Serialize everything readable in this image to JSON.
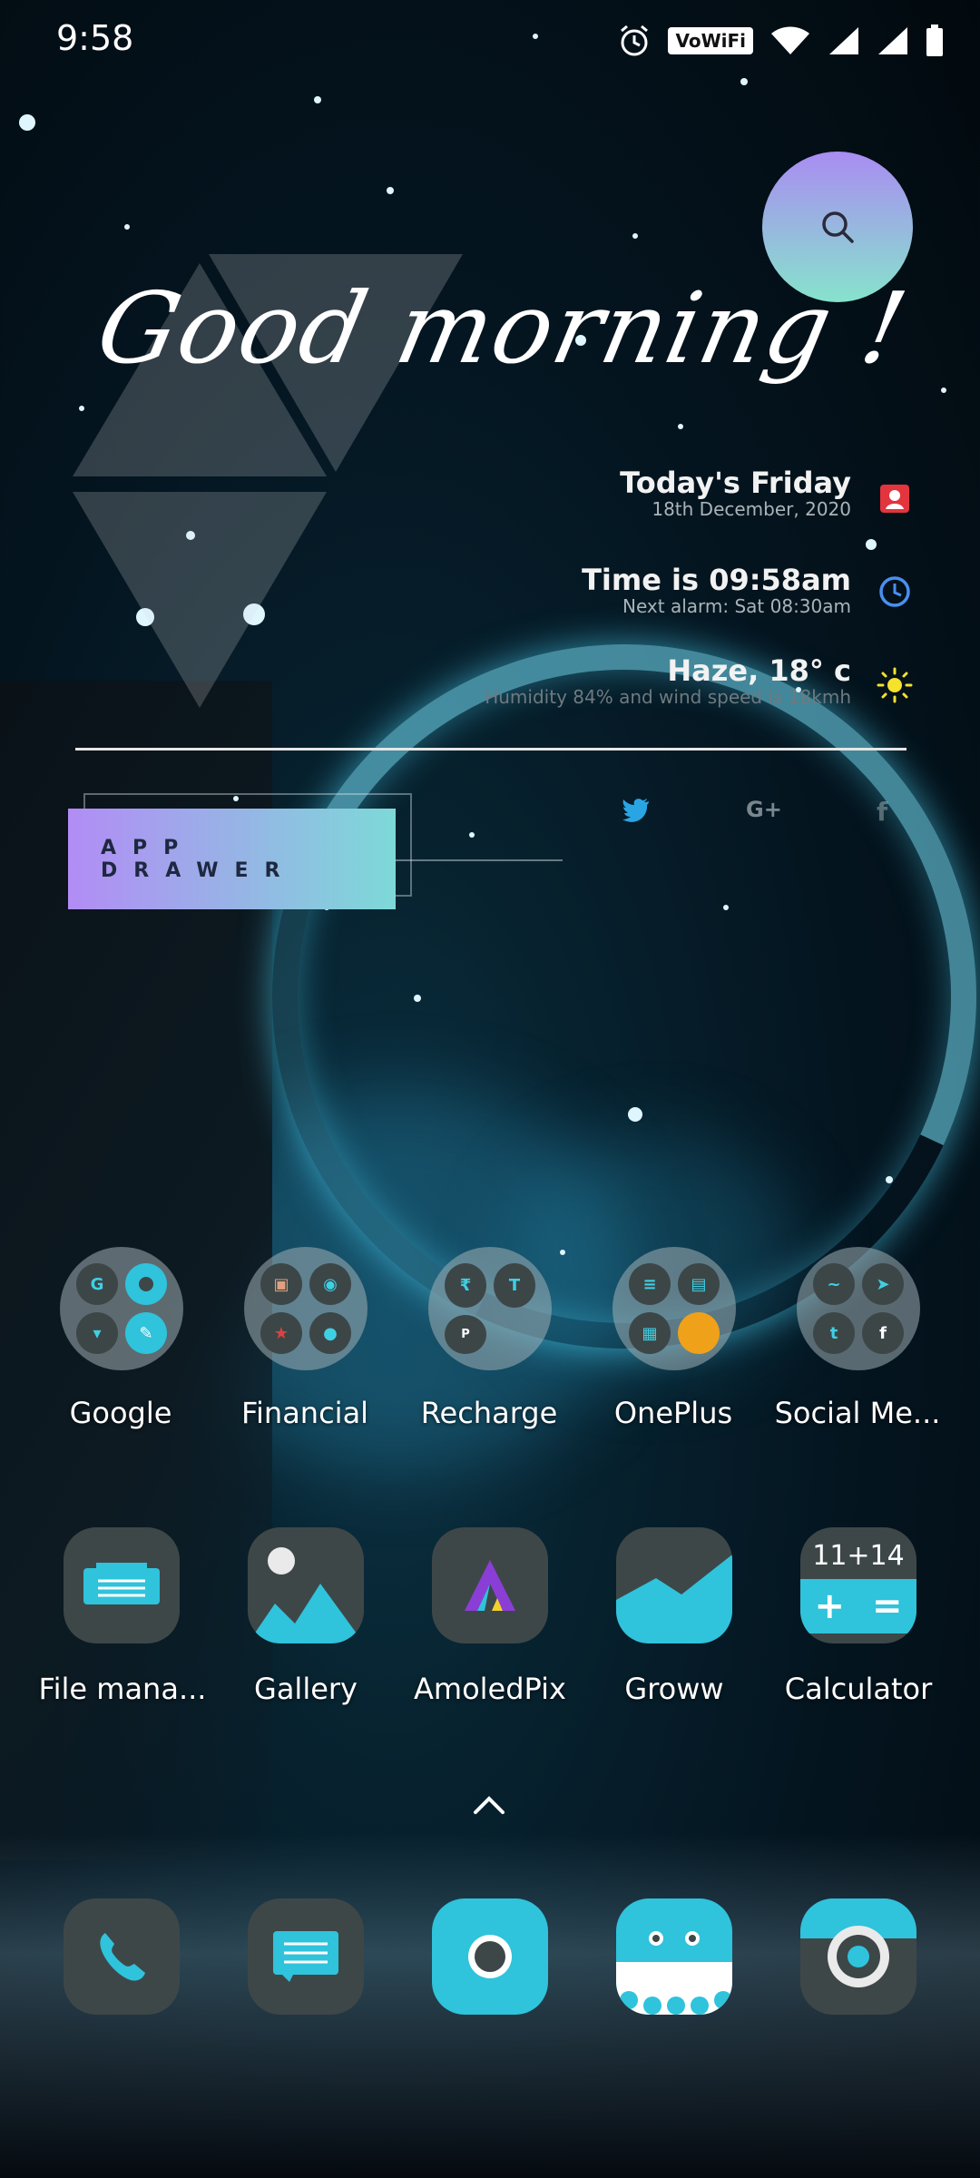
{
  "status_bar": {
    "time": "9:58",
    "badge": "VoWiFi"
  },
  "search": {
    "icon": "search-icon"
  },
  "greeting": "Good morning !",
  "info": {
    "date": {
      "main": "Today's Friday",
      "sub": "18th December, 2020"
    },
    "time": {
      "main": "Time is 09:58am",
      "sub": "Next alarm: Sat 08:30am"
    },
    "weather": {
      "main": "Haze, 18° c",
      "sub": "Humidity 84% and wind speed is 18kmh"
    }
  },
  "social": {
    "twitter": "twitter-icon",
    "google_plus": "G+",
    "facebook": "f"
  },
  "app_drawer": {
    "label": "APP DRAWER"
  },
  "folders": [
    {
      "label": "Google"
    },
    {
      "label": "Financial"
    },
    {
      "label": "Recharge"
    },
    {
      "label": "OnePlus"
    },
    {
      "label": "Social Me..."
    }
  ],
  "apps": [
    {
      "label": "File mana..."
    },
    {
      "label": "Gallery"
    },
    {
      "label": "AmoledPix"
    },
    {
      "label": "Groww"
    },
    {
      "label": "Calculator",
      "text": "11+14"
    }
  ],
  "dock": [
    "phone",
    "messages",
    "camera",
    "android",
    "camera-lens"
  ],
  "colors": {
    "accent": "#2fc3dc",
    "tile": "#3e4748"
  }
}
